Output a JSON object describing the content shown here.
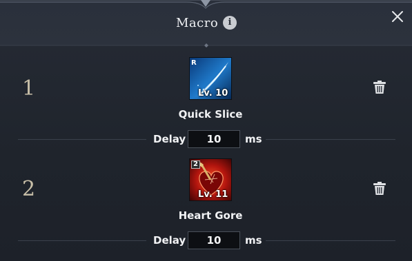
{
  "window": {
    "title": "Macro",
    "info_icon": "info-icon",
    "info_glyph": "i",
    "close_icon": "close-icon"
  },
  "steps": [
    {
      "number": "1",
      "skill": {
        "name": "Quick Slice",
        "badge": "R",
        "level": "Lv. 10",
        "icon": "blue-slash-skill-icon"
      },
      "delay_label": "Delay",
      "delay_value": "10",
      "unit": "ms",
      "delete_icon": "trash-icon"
    },
    {
      "number": "2",
      "skill": {
        "name": "Heart Gore",
        "badge": "2",
        "level": "Lv. 11",
        "icon": "red-heart-skill-icon"
      },
      "delay_label": "Delay",
      "delay_value": "10",
      "unit": "ms",
      "delete_icon": "trash-icon"
    }
  ],
  "colors": {
    "background": "#1f242d",
    "header": "#2a303b",
    "number": "#c8bfa8",
    "input_bg": "#0d0f13"
  }
}
